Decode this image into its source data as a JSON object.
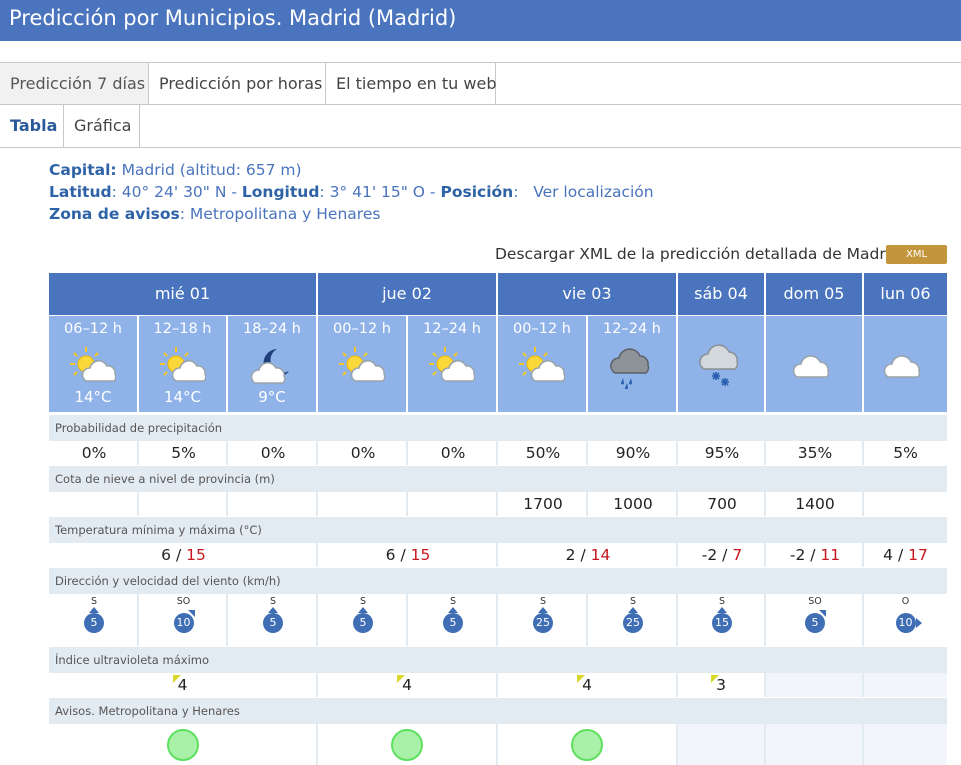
{
  "page_title": "Predicción por Municipios. Madrid (Madrid)",
  "tabs": [
    "Predicción 7 días",
    "Predicción por horas",
    "El tiempo en tu web"
  ],
  "subtabs": [
    "Tabla",
    "Gráfica"
  ],
  "info": {
    "capital_label": "Capital:",
    "capital_value": "Madrid (altitud: 657 m)",
    "lat_label": "Latitud",
    "lat_value": ": 40° 24' 30\" N - ",
    "lon_label": "Longitud",
    "lon_value": ": 3° 41' 15\" O - ",
    "pos_label": "Posición",
    "pos_value": ":   Ver localización",
    "zona_label": "Zona de avisos",
    "zona_value": ": Metropolitana y Henares"
  },
  "download_text": "Descargar XML de la predicción detallada de Madrid",
  "xml_label": "XML",
  "days": [
    "mié 01",
    "jue 02",
    "vie 03",
    "sáb 04",
    "dom 05",
    "lun 06"
  ],
  "slots": [
    {
      "label": "06–12 h",
      "temp": "14°C",
      "icon": "sun-cloud-icon"
    },
    {
      "label": "12–18 h",
      "temp": "14°C",
      "icon": "sun-cloud-icon"
    },
    {
      "label": "18–24 h",
      "temp": "9°C",
      "icon": "moon-cloud-icon"
    },
    {
      "label": "00–12 h",
      "temp": "",
      "icon": "sun-cloud-icon"
    },
    {
      "label": "12–24 h",
      "temp": "",
      "icon": "sun-cloud-icon"
    },
    {
      "label": "00–12 h",
      "temp": "",
      "icon": "sun-cloud-icon"
    },
    {
      "label": "12–24 h",
      "temp": "",
      "icon": "storm-rain-icon"
    },
    {
      "label": "",
      "temp": "",
      "icon": "snow-cloud-icon"
    },
    {
      "label": "",
      "temp": "",
      "icon": "cloud-icon"
    },
    {
      "label": "",
      "temp": "",
      "icon": "cloud-icon"
    }
  ],
  "rows": {
    "precip_label": "Probabilidad de precipitación",
    "precip": [
      "0%",
      "5%",
      "0%",
      "0%",
      "0%",
      "50%",
      "90%",
      "95%",
      "35%",
      "5%"
    ],
    "snow_label": "Cota de nieve a nivel de provincia (m)",
    "snow": [
      "",
      "",
      "",
      "",
      "",
      "1700",
      "1000",
      "700",
      "1400",
      ""
    ],
    "temp_label": "Temperatura mínima y máxima (°C)",
    "temps": [
      {
        "min": "6",
        "max": "15"
      },
      {
        "min": "6",
        "max": "15"
      },
      {
        "min": "2",
        "max": "14"
      },
      {
        "min": "-2",
        "max": "7"
      },
      {
        "min": "-2",
        "max": "11"
      },
      {
        "min": "4",
        "max": "17"
      }
    ],
    "temp_sep": " / ",
    "wind_label": "Dirección y velocidad del viento (km/h)",
    "wind": [
      {
        "dir": "S",
        "speed": "5"
      },
      {
        "dir": "SO",
        "speed": "10"
      },
      {
        "dir": "S",
        "speed": "5"
      },
      {
        "dir": "S",
        "speed": "5"
      },
      {
        "dir": "S",
        "speed": "5"
      },
      {
        "dir": "S",
        "speed": "25"
      },
      {
        "dir": "S",
        "speed": "25"
      },
      {
        "dir": "S",
        "speed": "15"
      },
      {
        "dir": "SO",
        "speed": "5"
      },
      {
        "dir": "O",
        "speed": "10"
      }
    ],
    "uv_label": "Índice ultravioleta máximo",
    "uv": [
      "4",
      "4",
      "4",
      "3",
      "",
      ""
    ],
    "avisos_label": "Avisos. Metropolitana y Henares"
  },
  "colors": {
    "header": "#4a74bd",
    "slots": "#8fb3e8",
    "label_row": "#e3ebf2",
    "xml": "#c3963b",
    "max_temp": "#c7161d",
    "warning_green": "#a9f0a9"
  }
}
